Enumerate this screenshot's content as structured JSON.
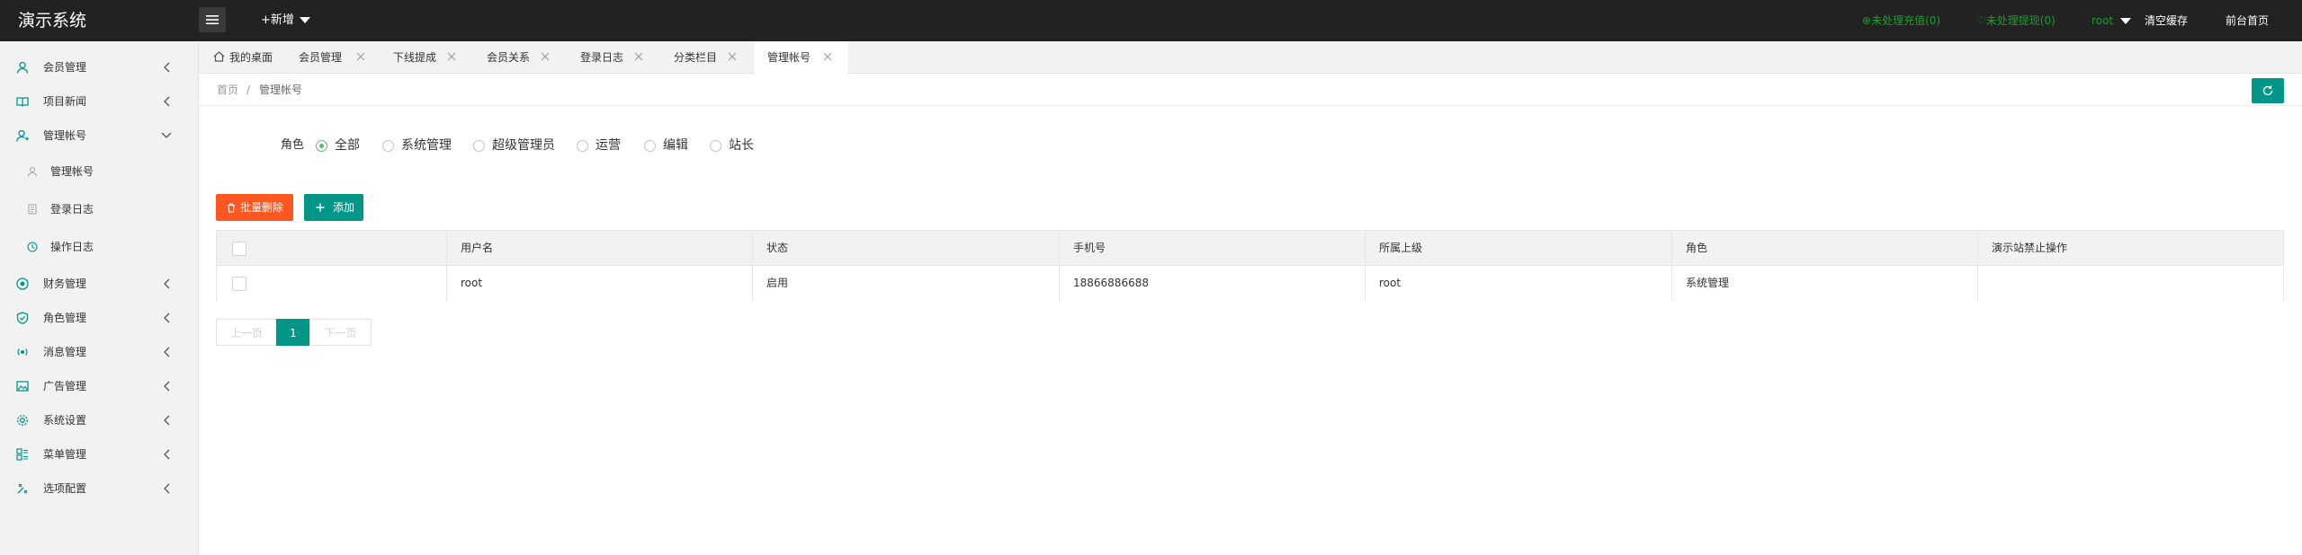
{
  "app": {
    "title": "演示系统"
  },
  "header": {
    "new_label": "+新增",
    "pending_recharge": "未处理充值(0)",
    "pending_withdraw": "未处理提现(0)",
    "user": "root",
    "clear_cache": "清空缓存",
    "frontend": "前台首页"
  },
  "sidebar": {
    "items": [
      {
        "label": "会员管理",
        "icon": "user-icon"
      },
      {
        "label": "项目新闻",
        "icon": "book-icon"
      },
      {
        "label": "管理帐号",
        "icon": "admin-icon"
      },
      {
        "label": "财务管理",
        "icon": "finance-icon"
      },
      {
        "label": "角色管理",
        "icon": "shield-icon"
      },
      {
        "label": "消息管理",
        "icon": "message-icon"
      },
      {
        "label": "广告管理",
        "icon": "image-icon"
      },
      {
        "label": "系统设置",
        "icon": "gear-icon"
      },
      {
        "label": "菜单管理",
        "icon": "menu-icon"
      },
      {
        "label": "选项配置",
        "icon": "tools-icon"
      }
    ],
    "sub_items": [
      {
        "label": "管理帐号",
        "icon": "user-icon"
      },
      {
        "label": "登录日志",
        "icon": "log-icon"
      },
      {
        "label": "操作日志",
        "icon": "clock-icon"
      }
    ]
  },
  "tabs": [
    {
      "label": "我的桌面"
    },
    {
      "label": "会员管理"
    },
    {
      "label": "下线提成"
    },
    {
      "label": "会员关系"
    },
    {
      "label": "登录日志"
    },
    {
      "label": "分类栏目"
    },
    {
      "label": "管理帐号"
    }
  ],
  "breadcrumb": {
    "home": "首页",
    "separator": "/",
    "current": "管理帐号"
  },
  "filter": {
    "label": "角色",
    "options": [
      "全部",
      "系统管理",
      "超级管理员",
      "运营",
      "编辑",
      "站长"
    ],
    "selected": "全部"
  },
  "toolbar": {
    "batch_delete": "批量删除",
    "add": "添加"
  },
  "table": {
    "columns": [
      "",
      "用户名",
      "状态",
      "手机号",
      "所属上级",
      "角色",
      "演示站禁止操作"
    ],
    "rows": [
      [
        "",
        "root",
        "启用",
        "18866886688",
        "root",
        "系统管理",
        ""
      ]
    ]
  },
  "pagination": {
    "prev": "上一页",
    "current": "1",
    "next": "下一页"
  },
  "colors": {
    "primary": "#009688",
    "danger": "#ff5722",
    "header_bg": "#222222",
    "pending_green": "#1e9d2f"
  }
}
